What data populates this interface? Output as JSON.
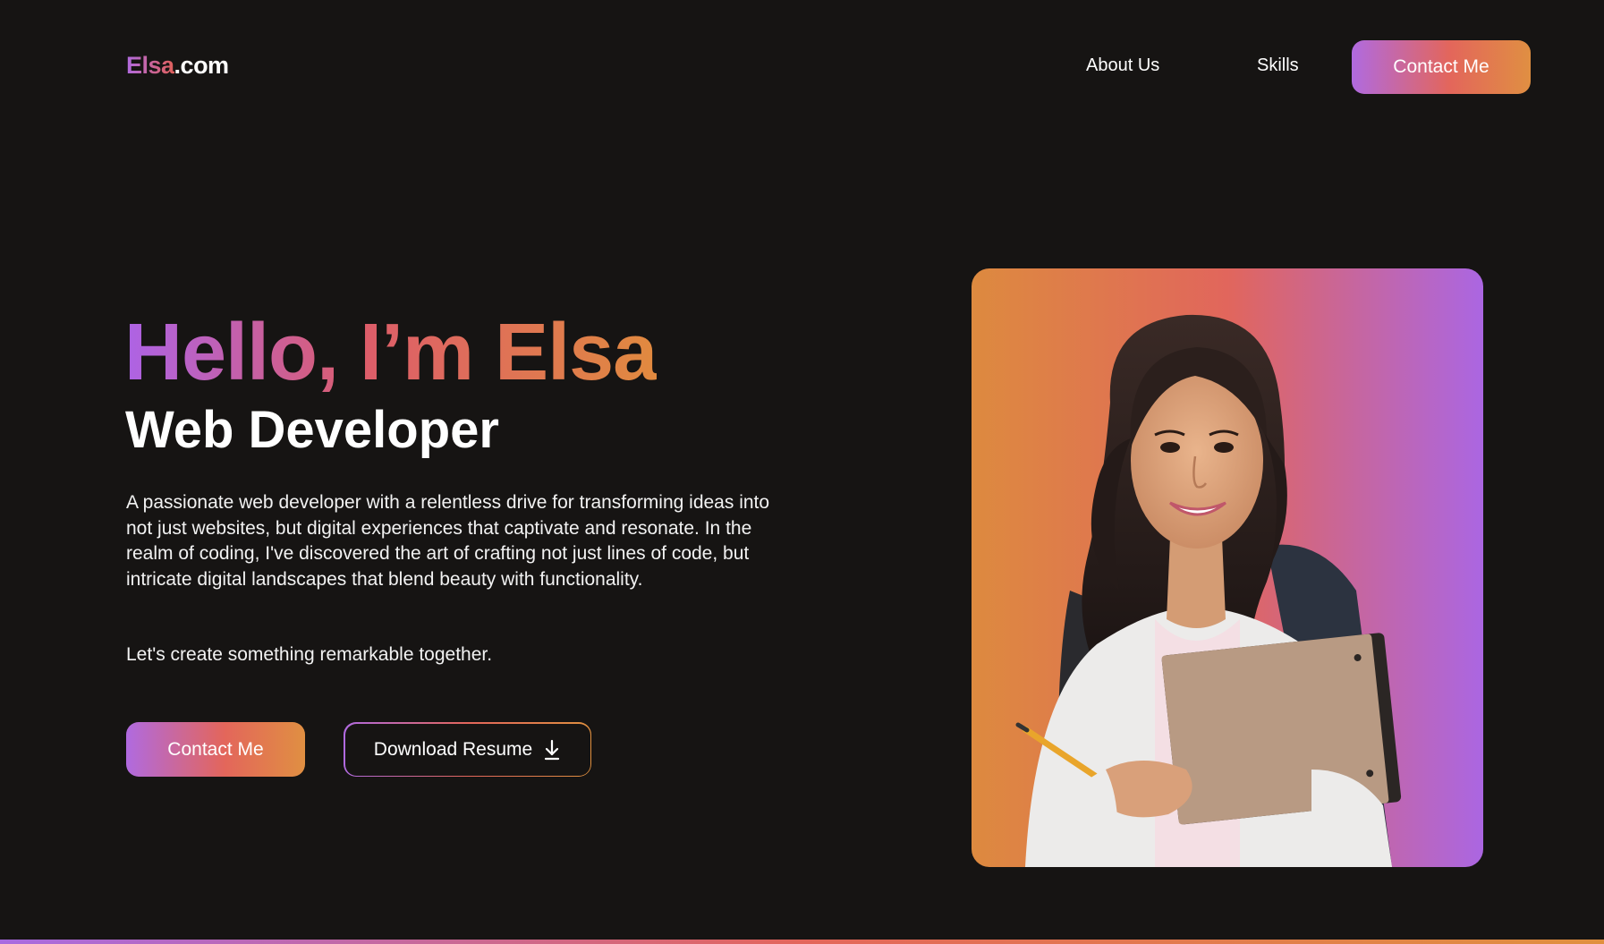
{
  "nav": {
    "logo_brand": "Elsa",
    "logo_tld": ".com",
    "links": [
      "About Us",
      "Skills"
    ],
    "contact_label": "Contact Me"
  },
  "hero": {
    "greeting": "Hello, I’m Elsa",
    "role": "Web Developer",
    "description": "A passionate web developer with a relentless drive for transforming ideas into not just websites, but digital experiences that captivate and resonate. In the realm of coding, I've discovered the art of crafting not just lines of code, but intricate digital landscapes that blend beauty with functionality.",
    "tagline": "Let's create something remarkable together.",
    "contact_label": "Contact Me",
    "download_label": "Download Resume",
    "download_icon": "download-arrow-icon"
  },
  "photo": {
    "subject": "portrait-photo"
  },
  "colors": {
    "background": "#161413",
    "gradient_purple": "#b06ae0",
    "gradient_coral": "#e3665b",
    "gradient_orange": "#e0903f",
    "text": "#ffffff"
  }
}
